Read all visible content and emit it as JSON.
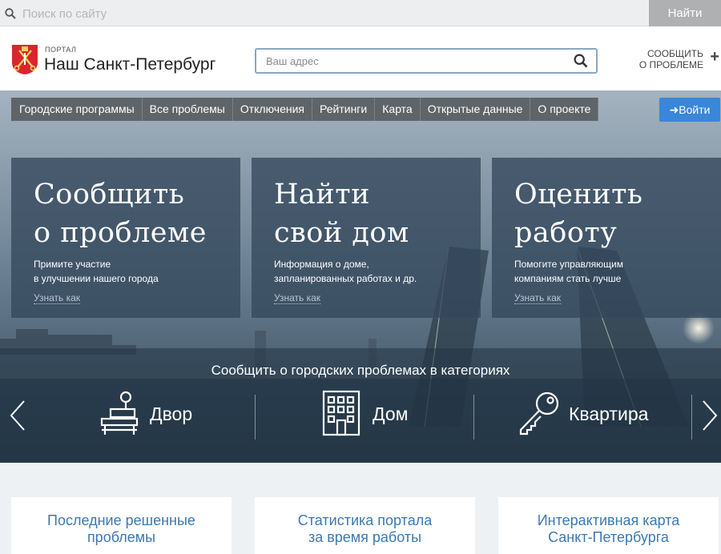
{
  "topbar": {
    "search_placeholder": "Поиск по сайту",
    "find_label": "Найти"
  },
  "header": {
    "logo_small": "ПОРТАЛ",
    "logo_title": "Наш Санкт-Петербург",
    "address_placeholder": "Ваш адрес",
    "report_line1": "СООБЩИТЬ",
    "report_line2": "О ПРОБЛЕМЕ",
    "report_plus": "+"
  },
  "nav": {
    "items": [
      "Городские программы",
      "Все проблемы",
      "Отключения",
      "Рейтинги",
      "Карта",
      "Открытые данные",
      "О проекте"
    ],
    "login_label": "Войти"
  },
  "cards": [
    {
      "title_line1": "Сообщить",
      "title_line2": "о проблеме",
      "desc_line1": "Примите участие",
      "desc_line2": "в улучшении нашего города",
      "link": "Узнать как"
    },
    {
      "title_line1": "Найти",
      "title_line2": "свой дом",
      "desc_line1": "Информация о доме,",
      "desc_line2": "запланированных работах и др.",
      "link": "Узнать как"
    },
    {
      "title_line1": "Оценить",
      "title_line2": "работу",
      "desc_line1": "Помогите управляющим",
      "desc_line2": "компаниям стать лучше",
      "link": "Узнать как"
    }
  ],
  "categories": {
    "heading": "Сообщить о городских проблемах в категориях",
    "items": [
      {
        "label": "Двор",
        "icon": "yard-bench-icon"
      },
      {
        "label": "Дом",
        "icon": "building-icon"
      },
      {
        "label": "Квартира",
        "icon": "key-icon"
      }
    ]
  },
  "bottom_cards": [
    {
      "line1": "Последние решенные",
      "line2": "проблемы"
    },
    {
      "line1": "Статистика портала",
      "line2": "за время работы"
    },
    {
      "line1": "Интерактивная карта",
      "line2": "Санкт-Петербурга"
    }
  ],
  "colors": {
    "accent_blue": "#3a86d8",
    "link_blue": "#3b79b3",
    "nav_gray": "#5f6468",
    "logo_red": "#d9262c"
  }
}
